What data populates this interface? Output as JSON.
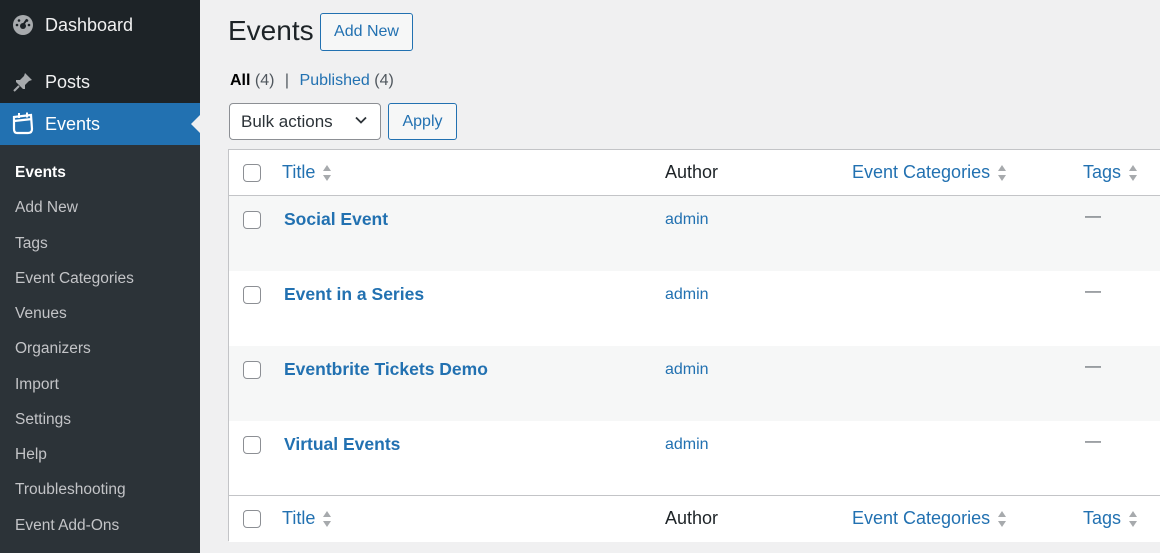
{
  "sidebar": {
    "dashboard": "Dashboard",
    "posts": "Posts",
    "events": "Events",
    "submenu": [
      "Events",
      "Add New",
      "Tags",
      "Event Categories",
      "Venues",
      "Organizers",
      "Import",
      "Settings",
      "Help",
      "Troubleshooting",
      "Event Add-Ons"
    ]
  },
  "header": {
    "title": "Events",
    "add_new": "Add New"
  },
  "filters": {
    "all_label": "All",
    "all_count": "(4)",
    "separator": "|",
    "published_label": "Published",
    "published_count": "(4)"
  },
  "bulk": {
    "selected": "Bulk actions",
    "apply": "Apply"
  },
  "table": {
    "columns": {
      "title": "Title",
      "author": "Author",
      "categories": "Event Categories",
      "tags": "Tags"
    },
    "rows": [
      {
        "title": "Social Event",
        "author": "admin",
        "tags": "—"
      },
      {
        "title": "Event in a Series",
        "author": "admin",
        "tags": "—"
      },
      {
        "title": "Eventbrite Tickets Demo",
        "author": "admin",
        "tags": "—"
      },
      {
        "title": "Virtual Events",
        "author": "admin",
        "tags": "—"
      }
    ]
  },
  "colors": {
    "sidebar_bg": "#1d2327",
    "submenu_bg": "#2c3338",
    "accent": "#2271b1",
    "page_bg": "#f0f0f1"
  },
  "icons": {
    "dashboard": "dashboard-icon",
    "posts": "pin-icon",
    "events": "calendar-icon",
    "bulk_chevron": "chevron-down-icon",
    "sort": "sort-icon"
  }
}
